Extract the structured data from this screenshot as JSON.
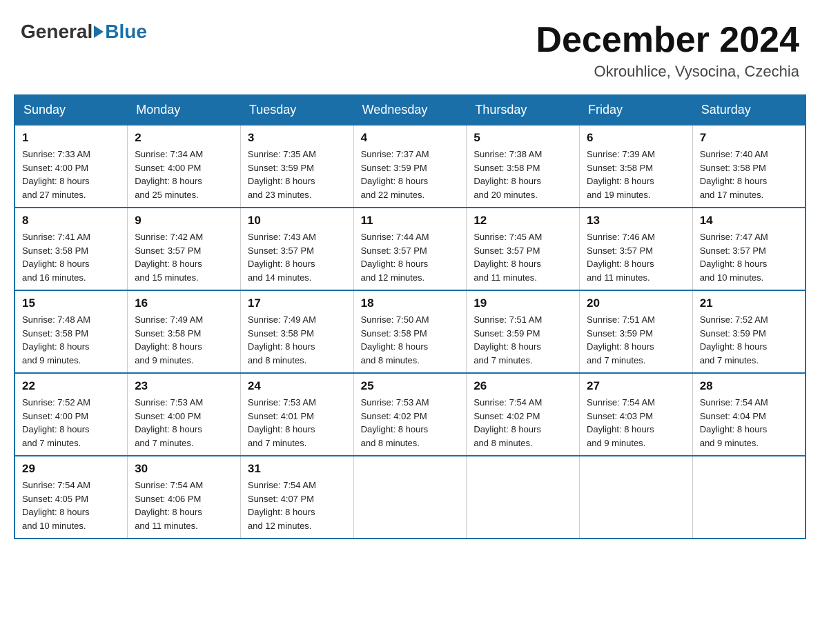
{
  "header": {
    "logo_general": "General",
    "logo_blue": "Blue",
    "month_title": "December 2024",
    "location": "Okrouhlice, Vysocina, Czechia"
  },
  "days_of_week": [
    "Sunday",
    "Monday",
    "Tuesday",
    "Wednesday",
    "Thursday",
    "Friday",
    "Saturday"
  ],
  "weeks": [
    [
      {
        "day": "1",
        "info": "Sunrise: 7:33 AM\nSunset: 4:00 PM\nDaylight: 8 hours\nand 27 minutes."
      },
      {
        "day": "2",
        "info": "Sunrise: 7:34 AM\nSunset: 4:00 PM\nDaylight: 8 hours\nand 25 minutes."
      },
      {
        "day": "3",
        "info": "Sunrise: 7:35 AM\nSunset: 3:59 PM\nDaylight: 8 hours\nand 23 minutes."
      },
      {
        "day": "4",
        "info": "Sunrise: 7:37 AM\nSunset: 3:59 PM\nDaylight: 8 hours\nand 22 minutes."
      },
      {
        "day": "5",
        "info": "Sunrise: 7:38 AM\nSunset: 3:58 PM\nDaylight: 8 hours\nand 20 minutes."
      },
      {
        "day": "6",
        "info": "Sunrise: 7:39 AM\nSunset: 3:58 PM\nDaylight: 8 hours\nand 19 minutes."
      },
      {
        "day": "7",
        "info": "Sunrise: 7:40 AM\nSunset: 3:58 PM\nDaylight: 8 hours\nand 17 minutes."
      }
    ],
    [
      {
        "day": "8",
        "info": "Sunrise: 7:41 AM\nSunset: 3:58 PM\nDaylight: 8 hours\nand 16 minutes."
      },
      {
        "day": "9",
        "info": "Sunrise: 7:42 AM\nSunset: 3:57 PM\nDaylight: 8 hours\nand 15 minutes."
      },
      {
        "day": "10",
        "info": "Sunrise: 7:43 AM\nSunset: 3:57 PM\nDaylight: 8 hours\nand 14 minutes."
      },
      {
        "day": "11",
        "info": "Sunrise: 7:44 AM\nSunset: 3:57 PM\nDaylight: 8 hours\nand 12 minutes."
      },
      {
        "day": "12",
        "info": "Sunrise: 7:45 AM\nSunset: 3:57 PM\nDaylight: 8 hours\nand 11 minutes."
      },
      {
        "day": "13",
        "info": "Sunrise: 7:46 AM\nSunset: 3:57 PM\nDaylight: 8 hours\nand 11 minutes."
      },
      {
        "day": "14",
        "info": "Sunrise: 7:47 AM\nSunset: 3:57 PM\nDaylight: 8 hours\nand 10 minutes."
      }
    ],
    [
      {
        "day": "15",
        "info": "Sunrise: 7:48 AM\nSunset: 3:58 PM\nDaylight: 8 hours\nand 9 minutes."
      },
      {
        "day": "16",
        "info": "Sunrise: 7:49 AM\nSunset: 3:58 PM\nDaylight: 8 hours\nand 9 minutes."
      },
      {
        "day": "17",
        "info": "Sunrise: 7:49 AM\nSunset: 3:58 PM\nDaylight: 8 hours\nand 8 minutes."
      },
      {
        "day": "18",
        "info": "Sunrise: 7:50 AM\nSunset: 3:58 PM\nDaylight: 8 hours\nand 8 minutes."
      },
      {
        "day": "19",
        "info": "Sunrise: 7:51 AM\nSunset: 3:59 PM\nDaylight: 8 hours\nand 7 minutes."
      },
      {
        "day": "20",
        "info": "Sunrise: 7:51 AM\nSunset: 3:59 PM\nDaylight: 8 hours\nand 7 minutes."
      },
      {
        "day": "21",
        "info": "Sunrise: 7:52 AM\nSunset: 3:59 PM\nDaylight: 8 hours\nand 7 minutes."
      }
    ],
    [
      {
        "day": "22",
        "info": "Sunrise: 7:52 AM\nSunset: 4:00 PM\nDaylight: 8 hours\nand 7 minutes."
      },
      {
        "day": "23",
        "info": "Sunrise: 7:53 AM\nSunset: 4:00 PM\nDaylight: 8 hours\nand 7 minutes."
      },
      {
        "day": "24",
        "info": "Sunrise: 7:53 AM\nSunset: 4:01 PM\nDaylight: 8 hours\nand 7 minutes."
      },
      {
        "day": "25",
        "info": "Sunrise: 7:53 AM\nSunset: 4:02 PM\nDaylight: 8 hours\nand 8 minutes."
      },
      {
        "day": "26",
        "info": "Sunrise: 7:54 AM\nSunset: 4:02 PM\nDaylight: 8 hours\nand 8 minutes."
      },
      {
        "day": "27",
        "info": "Sunrise: 7:54 AM\nSunset: 4:03 PM\nDaylight: 8 hours\nand 9 minutes."
      },
      {
        "day": "28",
        "info": "Sunrise: 7:54 AM\nSunset: 4:04 PM\nDaylight: 8 hours\nand 9 minutes."
      }
    ],
    [
      {
        "day": "29",
        "info": "Sunrise: 7:54 AM\nSunset: 4:05 PM\nDaylight: 8 hours\nand 10 minutes."
      },
      {
        "day": "30",
        "info": "Sunrise: 7:54 AM\nSunset: 4:06 PM\nDaylight: 8 hours\nand 11 minutes."
      },
      {
        "day": "31",
        "info": "Sunrise: 7:54 AM\nSunset: 4:07 PM\nDaylight: 8 hours\nand 12 minutes."
      },
      null,
      null,
      null,
      null
    ]
  ]
}
